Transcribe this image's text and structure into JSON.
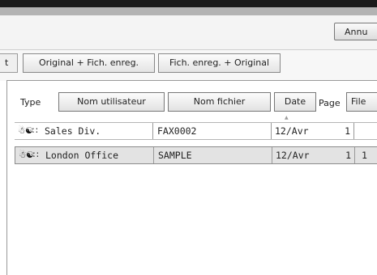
{
  "toolbar": {
    "cancel_label": "Annu"
  },
  "filter": {
    "partial_tab_label": "t",
    "tabs": [
      "Original + Fich. enreg.",
      "Fich. enreg. + Original"
    ]
  },
  "list": {
    "headers": {
      "type": "Type",
      "user": "Nom utilisateur",
      "file": "Nom fichier",
      "date": "Date",
      "page": "Page",
      "extra": "File"
    },
    "rows": [
      {
        "icons": "☃☯∷",
        "user": "Sales Div.",
        "file": "FAX0002",
        "date": "12/Avr",
        "pages": "1",
        "extra": "",
        "selected": false
      },
      {
        "icons": "☃☯∷",
        "user": "London Office",
        "file": "SAMPLE",
        "date": "12/Avr",
        "pages": "1",
        "extra": "1",
        "selected": true
      }
    ],
    "sort_indicator": "▲"
  }
}
